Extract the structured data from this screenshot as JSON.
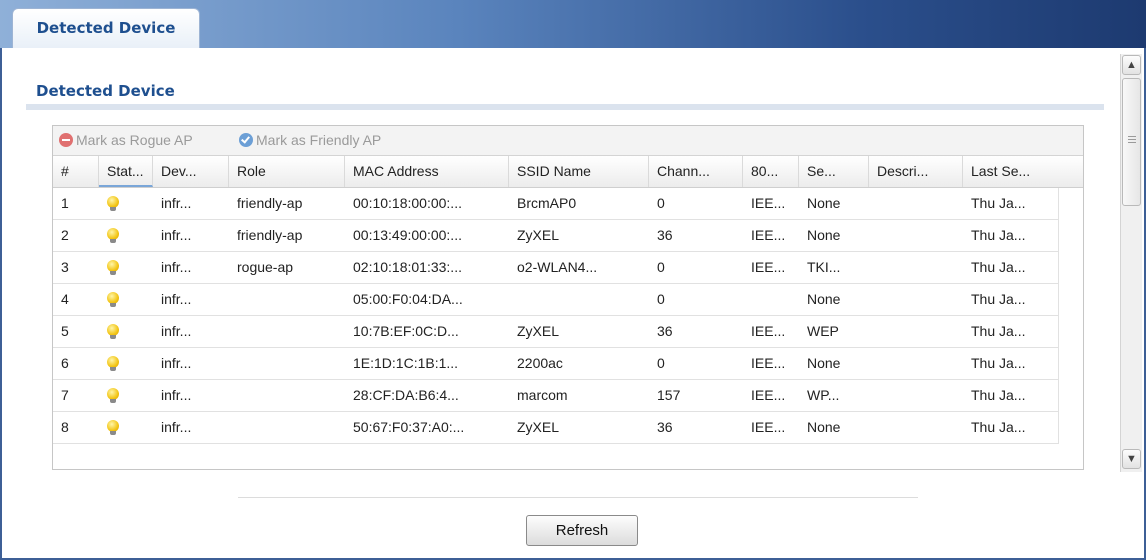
{
  "tab": {
    "label": "Detected Device"
  },
  "section": {
    "title": "Detected Device"
  },
  "toolbar": {
    "mark_rogue": "Mark as Rogue AP",
    "mark_friendly": "Mark as Friendly AP"
  },
  "columns": [
    "#",
    "Stat...",
    "Dev...",
    "Role",
    "MAC Address",
    "SSID Name",
    "Chann...",
    "80...",
    "Se...",
    "Descri...",
    "Last Se..."
  ],
  "rows": [
    {
      "num": "1",
      "device": "infr...",
      "role": "friendly-ap",
      "mac": "00:10:18:00:00:...",
      "ssid": "BrcmAP0",
      "channel": "0",
      "std": "IEE...",
      "security": "None",
      "desc": "",
      "last_seen": "Thu Ja..."
    },
    {
      "num": "2",
      "device": "infr...",
      "role": "friendly-ap",
      "mac": "00:13:49:00:00:...",
      "ssid": "ZyXEL",
      "channel": "36",
      "std": "IEE...",
      "security": "None",
      "desc": "",
      "last_seen": "Thu Ja..."
    },
    {
      "num": "3",
      "device": "infr...",
      "role": "rogue-ap",
      "mac": "02:10:18:01:33:...",
      "ssid": "o2-WLAN4...",
      "channel": "0",
      "std": "IEE...",
      "security": "TKI...",
      "desc": "",
      "last_seen": "Thu Ja..."
    },
    {
      "num": "4",
      "device": "infr...",
      "role": "",
      "mac": "05:00:F0:04:DA...",
      "ssid": "",
      "channel": "0",
      "std": "",
      "security": "None",
      "desc": "",
      "last_seen": "Thu Ja..."
    },
    {
      "num": "5",
      "device": "infr...",
      "role": "",
      "mac": "10:7B:EF:0C:D...",
      "ssid": "ZyXEL",
      "channel": "36",
      "std": "IEE...",
      "security": "WEP",
      "desc": "",
      "last_seen": "Thu Ja..."
    },
    {
      "num": "6",
      "device": "infr...",
      "role": "",
      "mac": "1E:1D:1C:1B:1...",
      "ssid": "2200ac",
      "channel": "0",
      "std": "IEE...",
      "security": "None",
      "desc": "",
      "last_seen": "Thu Ja..."
    },
    {
      "num": "7",
      "device": "infr...",
      "role": "",
      "mac": "28:CF:DA:B6:4...",
      "ssid": "marcom",
      "channel": "157",
      "std": "IEE...",
      "security": "WP...",
      "desc": "",
      "last_seen": "Thu Ja..."
    },
    {
      "num": "8",
      "device": "infr...",
      "role": "",
      "mac": "50:67:F0:37:A0:...",
      "ssid": "ZyXEL",
      "channel": "36",
      "std": "IEE...",
      "security": "None",
      "desc": "",
      "last_seen": "Thu Ja..."
    }
  ],
  "status_icon": "lightbulb-icon",
  "buttons": {
    "refresh": "Refresh"
  },
  "colors": {
    "accent": "#1e4f8f",
    "header_dark": "#1d3a70",
    "rogue": "#e07070",
    "friendly": "#6c9fd6"
  }
}
